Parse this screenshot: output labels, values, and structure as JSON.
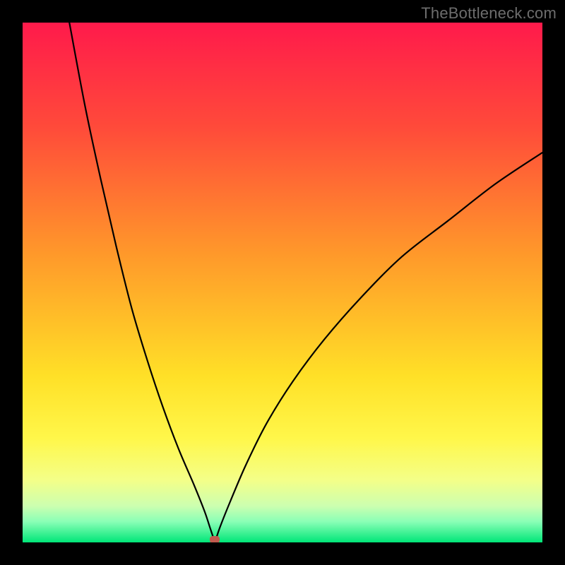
{
  "watermark": "TheBottleneck.com",
  "colors": {
    "frame": "#000000",
    "gradient_stops": [
      {
        "offset": 0.0,
        "color": "#ff1a4b"
      },
      {
        "offset": 0.2,
        "color": "#ff4a3a"
      },
      {
        "offset": 0.45,
        "color": "#ff9a2a"
      },
      {
        "offset": 0.68,
        "color": "#ffe027"
      },
      {
        "offset": 0.8,
        "color": "#fff74a"
      },
      {
        "offset": 0.88,
        "color": "#f4ff88"
      },
      {
        "offset": 0.93,
        "color": "#ccffb0"
      },
      {
        "offset": 0.96,
        "color": "#8affb6"
      },
      {
        "offset": 1.0,
        "color": "#00e678"
      }
    ],
    "curve": "#000000",
    "marker": "#c15a4e"
  },
  "chart_data": {
    "type": "line",
    "title": "",
    "xlabel": "",
    "ylabel": "",
    "xlim": [
      0,
      100
    ],
    "ylim": [
      0,
      100
    ],
    "minimum": {
      "x": 37,
      "y": 0
    },
    "series": [
      {
        "name": "left-branch",
        "x": [
          9,
          12,
          15,
          18,
          21,
          24,
          27,
          30,
          33,
          35,
          36,
          37
        ],
        "y": [
          100,
          84,
          70,
          57,
          45,
          35,
          26,
          18,
          11,
          6,
          3,
          0
        ]
      },
      {
        "name": "right-branch",
        "x": [
          37,
          38,
          40,
          43,
          47,
          52,
          58,
          65,
          73,
          82,
          91,
          100
        ],
        "y": [
          0,
          3,
          8,
          15,
          23,
          31,
          39,
          47,
          55,
          62,
          69,
          75
        ]
      }
    ],
    "marker_points": [
      {
        "x": 37,
        "y": 0
      }
    ]
  }
}
